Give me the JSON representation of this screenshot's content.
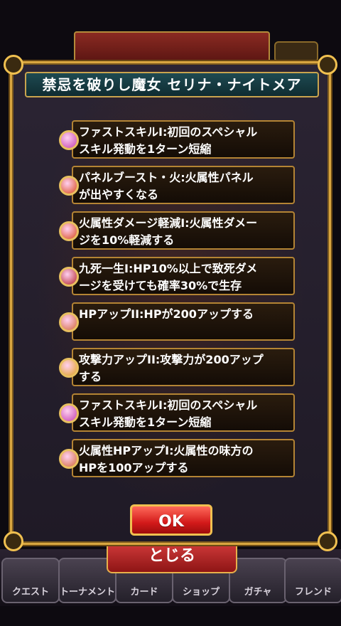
{
  "background": {
    "tabs": [
      "クエスト",
      "トーナメント",
      "カード",
      "ショップ",
      "ガチャ",
      "フレンド"
    ],
    "close_label": "とじる"
  },
  "modal": {
    "title": "禁忌を破りし魔女 セリナ・ナイトメア",
    "ok_label": "OK",
    "skills": [
      {
        "line1": "ファストスキルI:初回のスペシャル",
        "line2": "スキル発動を1ターン短縮",
        "icon": "fast-skill-icon",
        "icon_color": "#c23fb0"
      },
      {
        "line1": "パネルブースト・火:火属性パネル",
        "line2": "が出やすくなる",
        "icon": "fire-panel-icon",
        "icon_color": "#d84a1c"
      },
      {
        "line1": "火属性ダメージ軽減I:火属性ダメー",
        "line2": "ジを10%軽減する",
        "icon": "fire-guard-icon",
        "icon_color": "#d84a1c"
      },
      {
        "line1": "九死一生I:HP10%以上で致死ダメ",
        "line2": "ージを受けても確率30%で生存",
        "icon": "survive-icon",
        "icon_color": "#b0242a"
      },
      {
        "line1": "HPアップII:HPが200アップする",
        "line2": "",
        "icon": "hp-up-icon",
        "icon_color": "#d2683a"
      },
      {
        "line1": "攻撃力アップII:攻撃力が200アップ",
        "line2": "する",
        "icon": "attack-up-icon",
        "icon_color": "#e0a020"
      },
      {
        "line1": "ファストスキルI:初回のスペシャル",
        "line2": "スキル発動を1ターン短縮",
        "icon": "fast-skill-icon",
        "icon_color": "#c23fb0"
      },
      {
        "line1": "火属性HPアップI:火属性の味方の",
        "line2": "HPを100アップする",
        "icon": "fire-hp-icon",
        "icon_color": "#d2683a"
      }
    ]
  }
}
